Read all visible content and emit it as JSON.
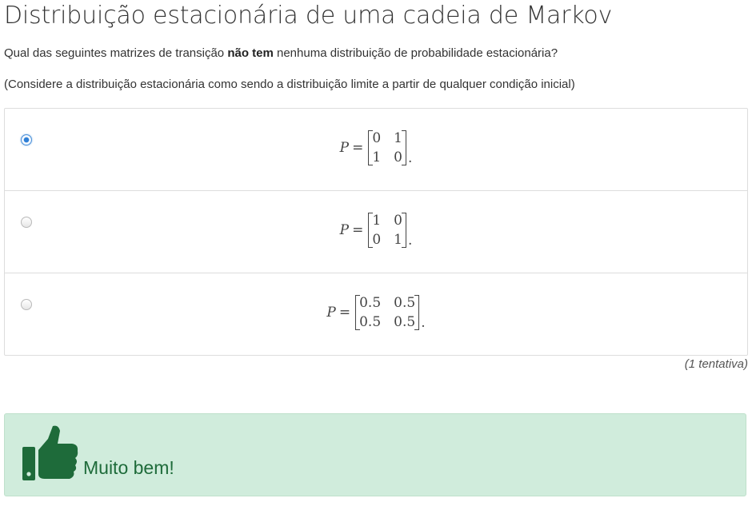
{
  "title": "Distribuição estacionária de uma cadeia de Markov",
  "question": {
    "before": "Qual das seguintes matrizes de transição ",
    "bold": "não tem",
    "after": " nenhuma distribuição de probabilidade estacionária?"
  },
  "note": "(Considere a distribuição estacionária como sendo a distribuição limite a partir de qualquer condição inicial)",
  "options": [
    {
      "selected": true,
      "variable": "P",
      "equals": "=",
      "matrix": [
        [
          "0",
          "1"
        ],
        [
          "1",
          "0"
        ]
      ],
      "suffix": "."
    },
    {
      "selected": false,
      "variable": "P",
      "equals": "=",
      "matrix": [
        [
          "1",
          "0"
        ],
        [
          "0",
          "1"
        ]
      ],
      "suffix": "."
    },
    {
      "selected": false,
      "variable": "P",
      "equals": "=",
      "matrix": [
        [
          "0.5",
          "0.5"
        ],
        [
          "0.5",
          "0.5"
        ]
      ],
      "suffix": "."
    }
  ],
  "attempts": "(1 tentativa)",
  "feedback": {
    "icon": "thumbs-up-icon",
    "text": "Muito bem!",
    "color": "#1e6b3a",
    "background": "#d0ecdc"
  },
  "colors": {
    "radio_selected": "#2f7fd6",
    "border": "#dddddd"
  }
}
